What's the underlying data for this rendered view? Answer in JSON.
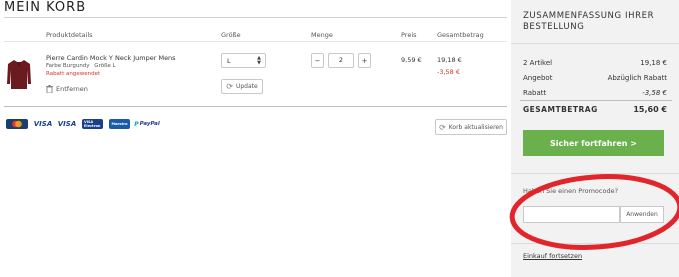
{
  "cart": {
    "title": "MEIN KORB",
    "headers": {
      "product": "Produktdetails",
      "size": "Größe",
      "quantity": "Menge",
      "price": "Preis",
      "total": "Gesamtbetrag"
    },
    "item": {
      "name": "Pierre Cardin Mock Y Neck Jumper Mens",
      "color": "Farbe Burgundy",
      "size_text": "Größe L",
      "discount_applied": "Rabatt angewendet",
      "remove_label": "Entfernen",
      "size_value": "L",
      "update_label": "Update",
      "quantity": "2",
      "qty_minus": "−",
      "qty_plus": "+",
      "price": "9,59 €",
      "total": "19,18 €",
      "total_discount": "-3,58 €"
    },
    "payment_methods": [
      "MasterCard",
      "VISA",
      "VISA",
      "VISA Electron",
      "Maestro",
      "PayPal"
    ],
    "update_cart_label": "Korb aktualisieren"
  },
  "summary": {
    "title": "ZUSAMMENFASSUNG IHRER BESTELLUNG",
    "rows": [
      {
        "label": "2 Artikel",
        "value": "19,18 €"
      },
      {
        "label": "Angebot",
        "value": "Abzüglich Rabatt"
      },
      {
        "label": "Rabatt",
        "value": "-3,58 €"
      }
    ],
    "grand_total_label": "GESAMTBETRAG",
    "grand_total_value": "15,60 €",
    "checkout_label": "Sicher fortfahren >",
    "promo_label": "Haben Sie einen Promocode?",
    "promo_placeholder": "",
    "promo_button": "Anwenden",
    "continue_label": "Einkauf fortsetzen"
  },
  "colors": {
    "accent_green": "#6ab04c",
    "discount_red": "#d0342c",
    "highlight_red": "#e0262b",
    "product_burgundy": "#6b1a20"
  }
}
